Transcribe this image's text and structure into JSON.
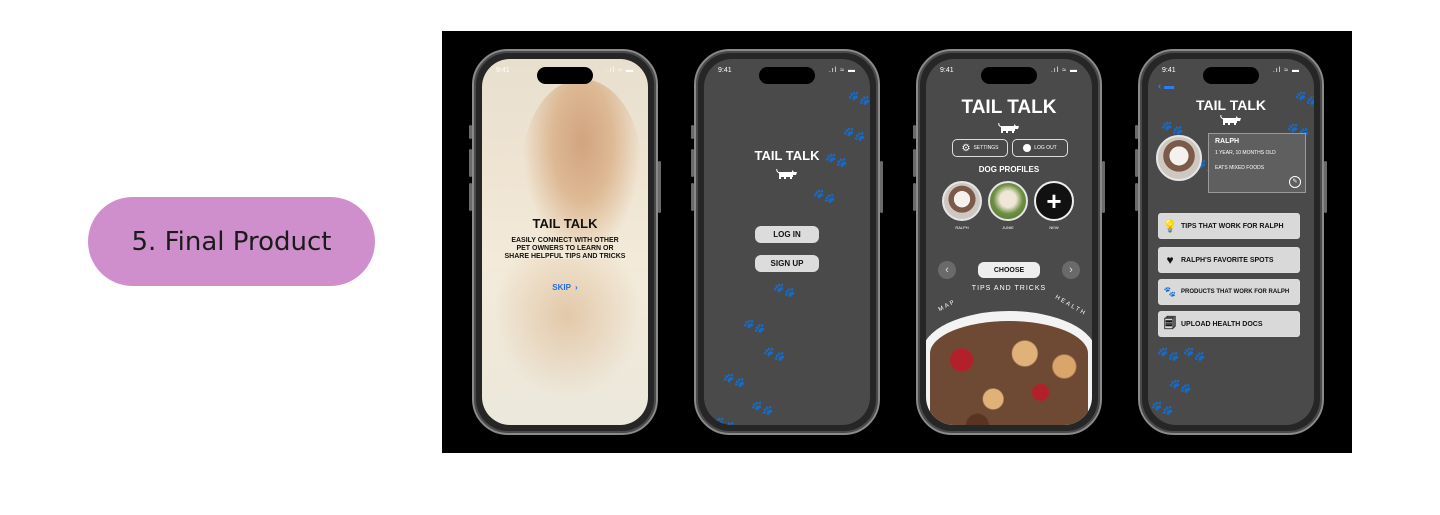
{
  "slide": {
    "label": "5. Final Product",
    "accent": "#cf8fcd"
  },
  "status_time": "9:41",
  "screen1": {
    "title": "TAIL TALK",
    "tagline": "EASILY CONNECT WITH OTHER PET OWNERS TO LEARN OR SHARE HELPFUL TIPS AND TRICKS",
    "skip": "SKIP"
  },
  "screen2": {
    "title": "TAIL TALK",
    "login": "LOG IN",
    "signup": "SIGN UP"
  },
  "screen3": {
    "title": "TAIL TALK",
    "settings": "SETTINGS",
    "logout": "LOG OUT",
    "section": "DOG PROFILES",
    "profiles": [
      "RALPH",
      "JUNIE",
      "NEW"
    ],
    "choose": "CHOOSE",
    "carousel": [
      "MAP",
      "TIPS AND TRICKS",
      "HEALTH"
    ]
  },
  "screen4": {
    "title": "TAIL TALK",
    "back_icon": "chevron-left-icon",
    "dog": {
      "name": "RALPH",
      "age": "1 YEAR, 10 MONTHS OLD",
      "food": "EATS MIXED FOODS"
    },
    "features": [
      {
        "icon": "lightbulb-icon",
        "label": "TIPS THAT WORK FOR RALPH"
      },
      {
        "icon": "heart-icon",
        "label": "RALPH'S FAVORITE SPOTS"
      },
      {
        "icon": "paw-icon",
        "label": "PRODUCTS THAT WORK FOR RALPH"
      },
      {
        "icon": "document-icon",
        "label": "UPLOAD HEALTH DOCS"
      }
    ]
  }
}
